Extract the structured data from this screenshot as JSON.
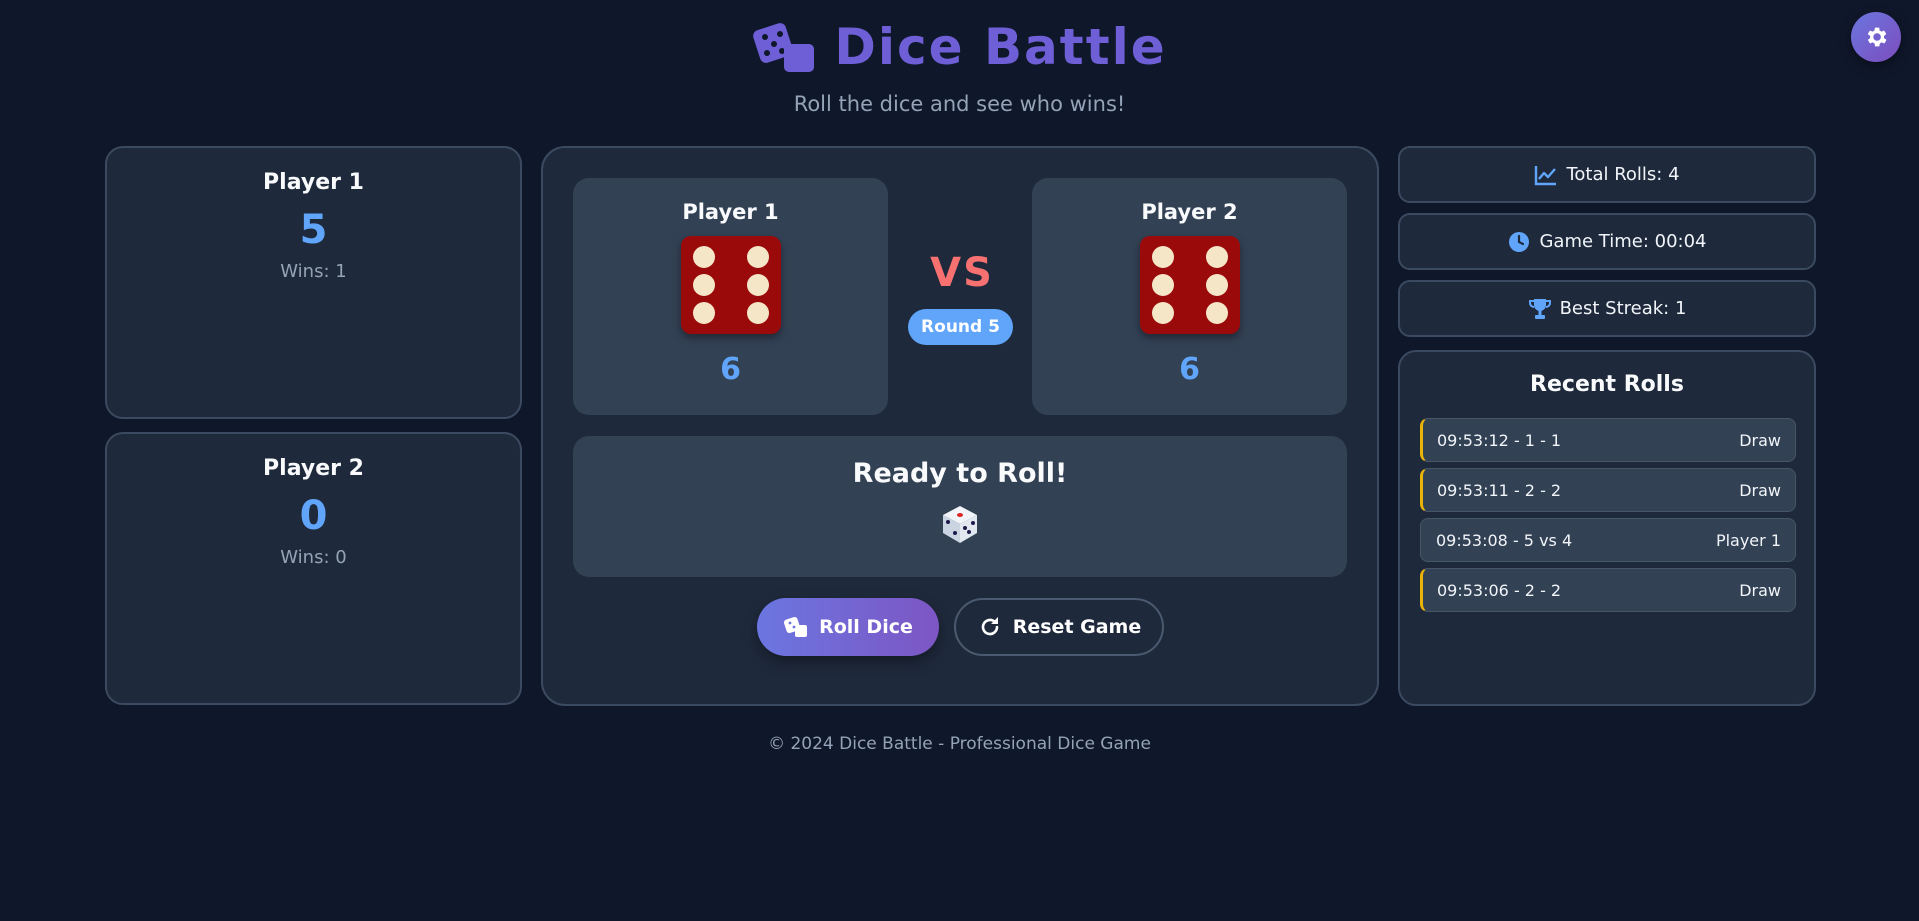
{
  "header": {
    "title": "Dice Battle",
    "subtitle": "Roll the dice and see who wins!"
  },
  "settings": {
    "icon": "gear-icon"
  },
  "scoreboard": {
    "players": [
      {
        "name": "Player 1",
        "score": "5",
        "wins": "Wins: 1"
      },
      {
        "name": "Player 2",
        "score": "0",
        "wins": "Wins: 0"
      }
    ]
  },
  "arena": {
    "dice": [
      {
        "label": "Player 1",
        "value": "6"
      },
      {
        "label": "Player 2",
        "value": "6"
      }
    ],
    "vs_label": "VS",
    "round_label": "Round 5",
    "status_text": "Ready to Roll!",
    "status_icon": "game-die-icon",
    "roll_button": "Roll Dice",
    "reset_button": "Reset Game"
  },
  "stats": {
    "total_rolls": "Total Rolls: 4",
    "game_time": "Game Time: 00:04",
    "best_streak": "Best Streak: 1"
  },
  "recent": {
    "title": "Recent Rolls",
    "items": [
      {
        "text": "09:53:12 - 1 - 1",
        "result": "Draw"
      },
      {
        "text": "09:53:11 - 2 - 2",
        "result": "Draw"
      },
      {
        "text": "09:53:08 - 5 vs 4",
        "result": "Player 1"
      },
      {
        "text": "09:53:06 - 2 - 2",
        "result": "Draw"
      }
    ]
  },
  "footer": {
    "text": "© 2024 Dice Battle - Professional Dice Game"
  },
  "colors": {
    "background": "#0f172a",
    "brand": "#6f5fd6",
    "accent_blue": "#60a5fa",
    "vs_red": "#f87171",
    "die_red": "#9b0a0a",
    "draw_yellow": "#eab308"
  }
}
